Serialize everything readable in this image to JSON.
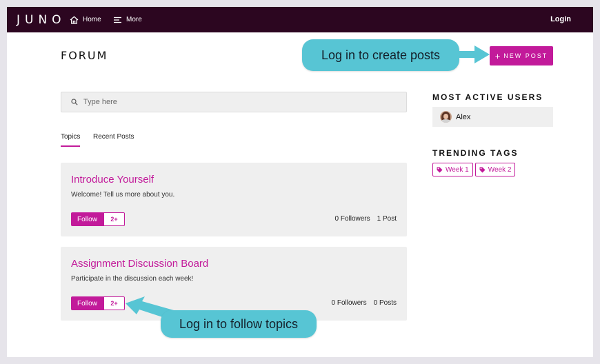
{
  "nav": {
    "logo": "JUNO",
    "home_label": "Home",
    "more_label": "More",
    "login_label": "Login"
  },
  "header": {
    "title": "FORUM",
    "new_post_label": "NEW POST"
  },
  "callouts": {
    "create_posts": "Log in to create posts",
    "follow_topics": "Log in to follow topics"
  },
  "search": {
    "placeholder": "Type here"
  },
  "tabs": [
    {
      "label": "Topics"
    },
    {
      "label": "Recent Posts"
    }
  ],
  "topics": [
    {
      "title": "Introduce Yourself",
      "description": "Welcome! Tell us more about you.",
      "follow_label": "Follow",
      "follow_count": "2+",
      "followers": "0 Followers",
      "posts": "1 Post"
    },
    {
      "title": "Assignment Discussion Board",
      "description": "Participate in the discussion each week!",
      "follow_label": "Follow",
      "follow_count": "2+",
      "followers": "0 Followers",
      "posts": "0 Posts"
    }
  ],
  "sidebar": {
    "active_users_heading": "MOST ACTIVE USERS",
    "users": [
      {
        "name": "Alex"
      }
    ],
    "trending_tags_heading": "TRENDING TAGS",
    "tags": [
      {
        "label": "Week 1"
      },
      {
        "label": "Week 2"
      }
    ]
  },
  "colors": {
    "accent": "#c21a9a",
    "nav_bg": "#2c0620",
    "callout_bg": "#57c5d4",
    "card_bg": "#efefef"
  },
  "icons": {
    "home": "home-icon",
    "more": "menu-icon",
    "search": "search-icon",
    "tag": "tag-icon"
  }
}
